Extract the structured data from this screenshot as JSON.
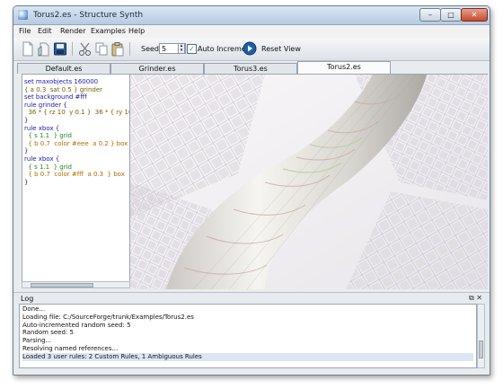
{
  "window": {
    "title": "Torus2.es - Structure Synth",
    "min_label": "–",
    "max_label": "□",
    "close_label": "✕"
  },
  "menu": [
    "File",
    "Edit",
    "Render",
    "Examples",
    "Help"
  ],
  "toolbar": {
    "seed_label": "Seed:",
    "seed_value": "5",
    "auto_increment_checked": true,
    "auto_increment_label": "Auto Increment",
    "reset_view_label": "Reset View",
    "icons": [
      "new-file-icon",
      "open-file-icon",
      "save-icon",
      "cut-icon",
      "copy-icon",
      "paste-icon",
      "reset-view-icon"
    ]
  },
  "tabs": [
    {
      "label": "Default.es",
      "active": false
    },
    {
      "label": "Grinder.es",
      "active": false
    },
    {
      "label": "Torus3.es",
      "active": false
    },
    {
      "label": "Torus2.es",
      "active": true
    }
  ],
  "editor": {
    "lines": [
      "set maxobjects 160000",
      "{ a 0.3  sat 0.5 } grinder",
      "set background #fff",
      "",
      "rule grinder {",
      "  36 * { rz 10  y 0.1 }  36 * { ry 10",
      "}",
      "",
      "rule xbox {",
      "  { s 1.1  } grid",
      "  { b 0.7  color #eee  a 0.2 } box",
      "}",
      "",
      "rule xbox {",
      "  { s 1.1  } grid",
      "  { b 0.7  color #fff  a 0.3  } box",
      "}"
    ]
  },
  "log": {
    "title": "Log",
    "lines": [
      "Done...",
      "Loading file: C:/SourceForge/trunk/Examples/Torus2.es",
      "Auto-incremented random seed: 5",
      "Random seed: 5",
      "Parsing...",
      "Resolving named references...",
      "Loaded 3 user rules: 2 Custom Rules, 1 Ambiguous Rules"
    ],
    "selected_index": 6
  },
  "colors": {
    "accent": "#1f5fa8",
    "background": "#ffffff"
  }
}
